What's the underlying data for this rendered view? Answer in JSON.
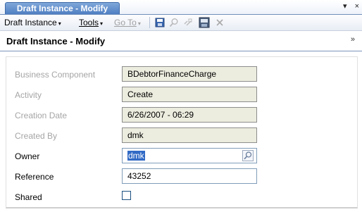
{
  "tab": {
    "title": "Draft Instance - Modify"
  },
  "window_controls": {
    "dropdown": "▾",
    "close": "×"
  },
  "toolbar": {
    "draft_instance": "Draft Instance",
    "tools": "Tools",
    "goto": "Go To",
    "caret": "▾"
  },
  "panel": {
    "title": "Draft Instance - Modify",
    "collapse": "»"
  },
  "fields": {
    "business_component": {
      "label": "Business Component",
      "value": "BDebtorFinanceCharge"
    },
    "activity": {
      "label": "Activity",
      "value": "Create"
    },
    "creation_date": {
      "label": "Creation Date",
      "value": "6/26/2007 - 06:29"
    },
    "created_by": {
      "label": "Created By",
      "value": "dmk"
    },
    "owner": {
      "label": "Owner",
      "value": "dmk"
    },
    "reference": {
      "label": "Reference",
      "value": "43252"
    },
    "shared": {
      "label": "Shared",
      "checked": false
    }
  },
  "colors": {
    "tab_active": "#5f8fcf",
    "readonly_field_bg": "#ececdf",
    "selection": "#316ac5",
    "disabled_label": "#a5a5a5"
  }
}
